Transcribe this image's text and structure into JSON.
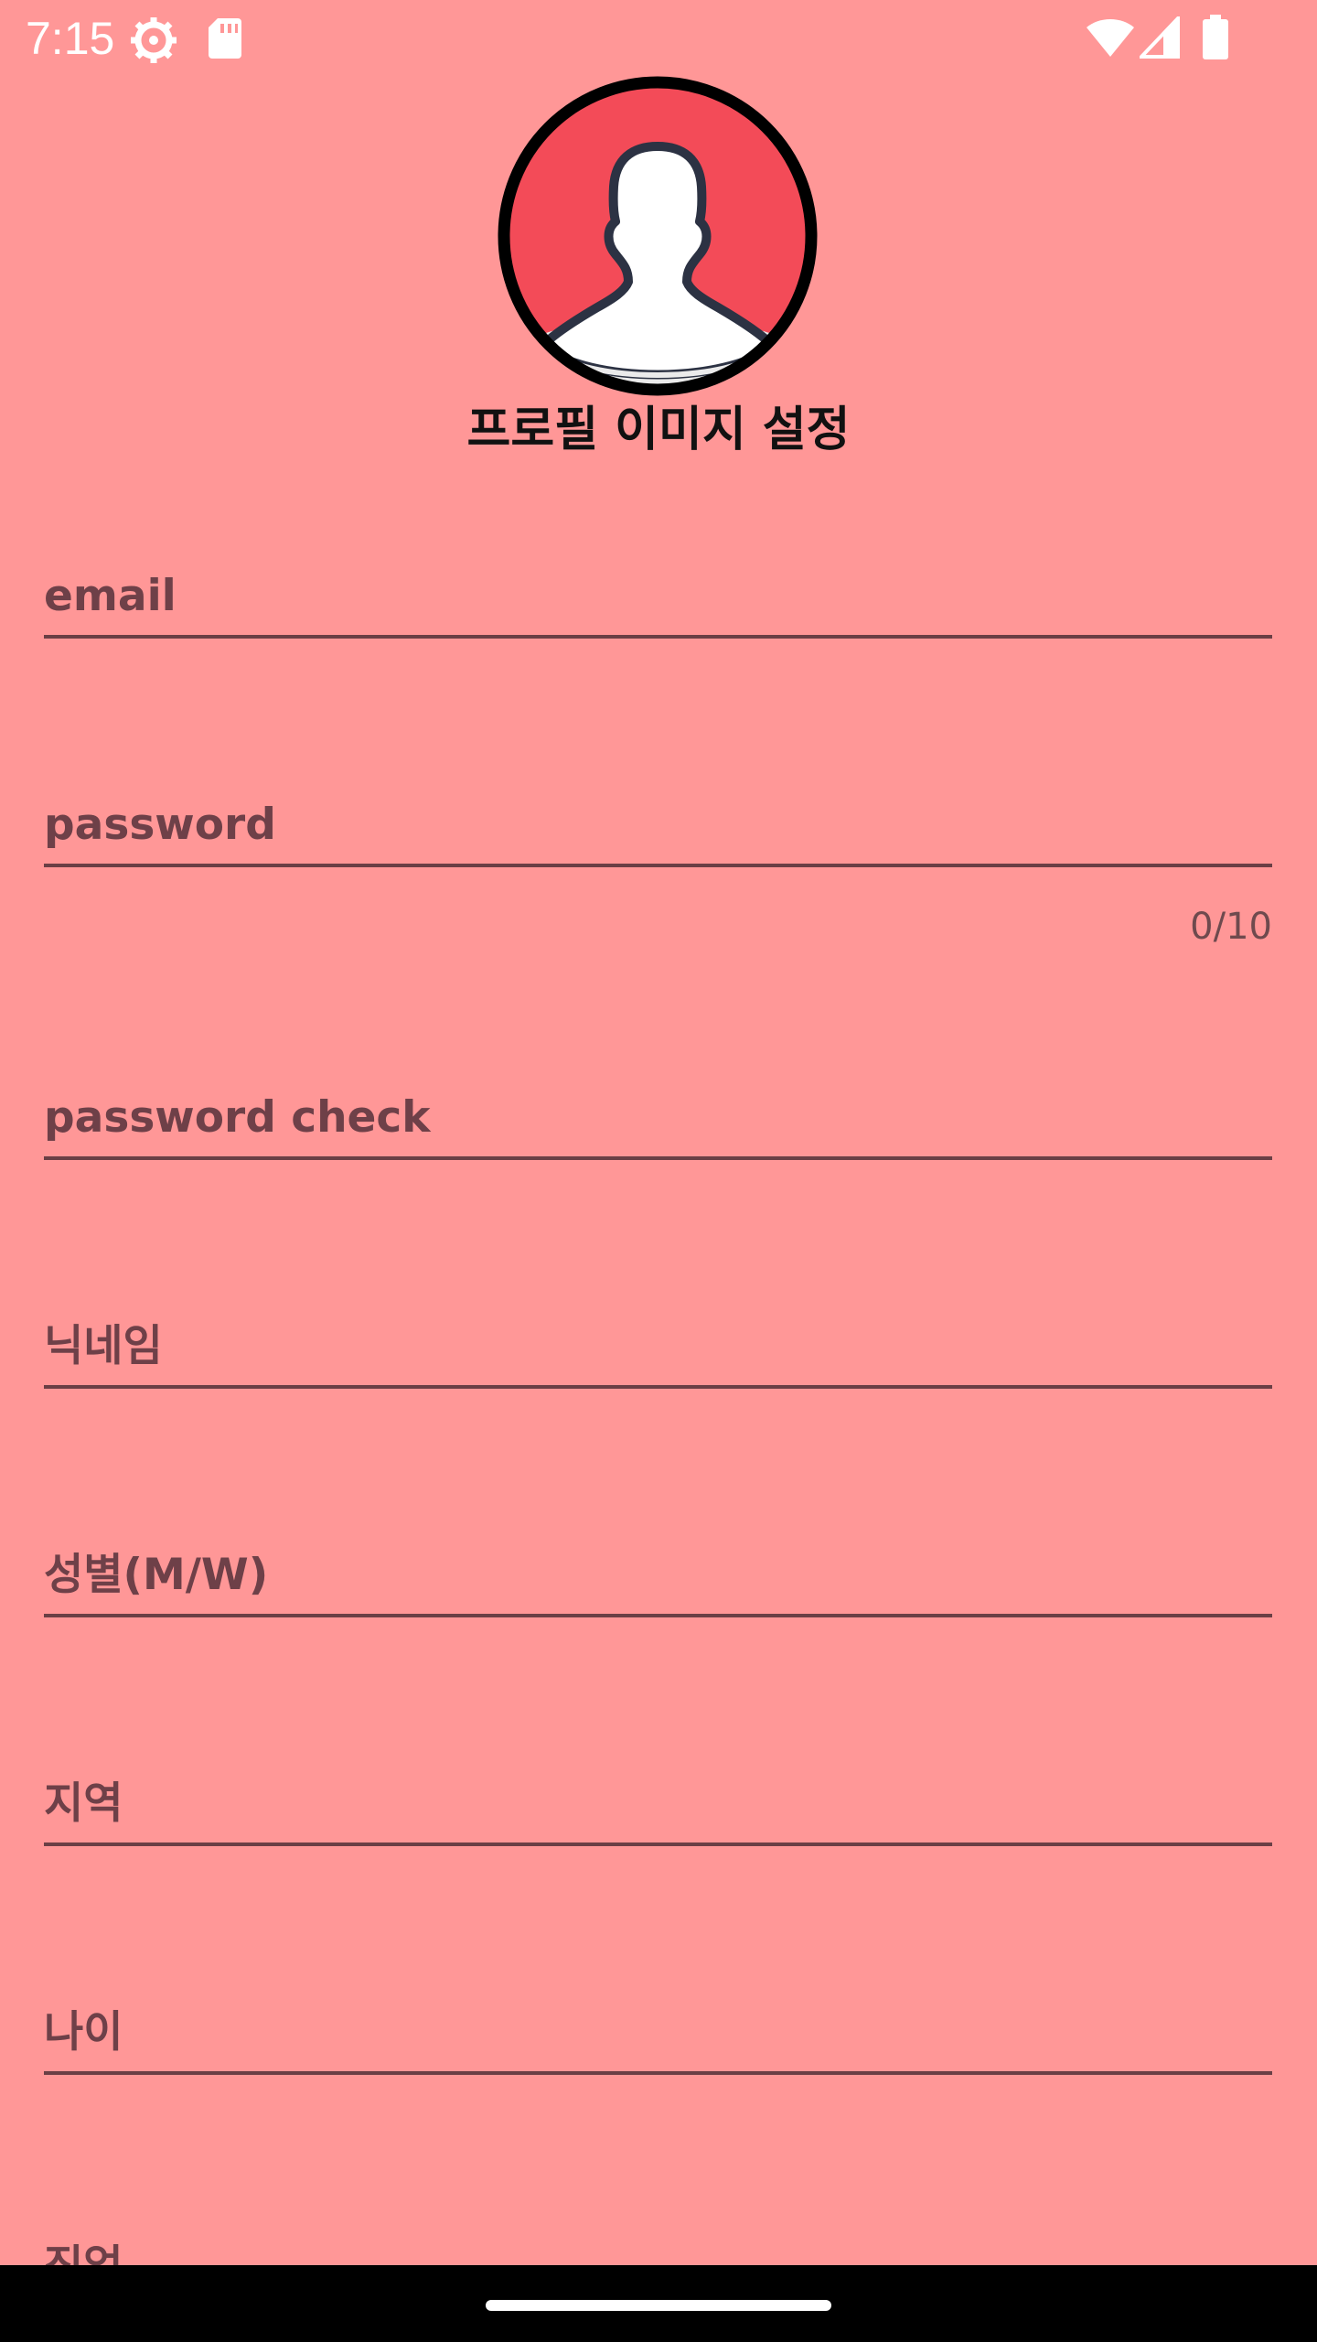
{
  "status_bar": {
    "time": "7:15",
    "icons": [
      "settings-gear-icon",
      "sd-card-icon",
      "wifi-icon",
      "cell-signal-icon",
      "battery-icon"
    ]
  },
  "profile": {
    "avatar_icon": "user-silhouette-icon",
    "title": "프로필 이미지 설정"
  },
  "form": {
    "email": {
      "placeholder": "email",
      "value": ""
    },
    "password": {
      "placeholder": "password",
      "value": "",
      "counter": "0/10"
    },
    "password_check": {
      "placeholder": "password check",
      "value": ""
    },
    "nickname": {
      "placeholder": "닉네임",
      "value": ""
    },
    "gender": {
      "placeholder": "성별(M/W)",
      "value": ""
    },
    "region": {
      "placeholder": "지역",
      "value": ""
    },
    "age": {
      "placeholder": "나이",
      "value": ""
    },
    "job": {
      "placeholder": "직업",
      "value": ""
    }
  },
  "colors": {
    "background": "#ff9797",
    "avatar_fill": "#f34b58",
    "underline": "#6a3f45",
    "nav_bar": "#000000"
  }
}
